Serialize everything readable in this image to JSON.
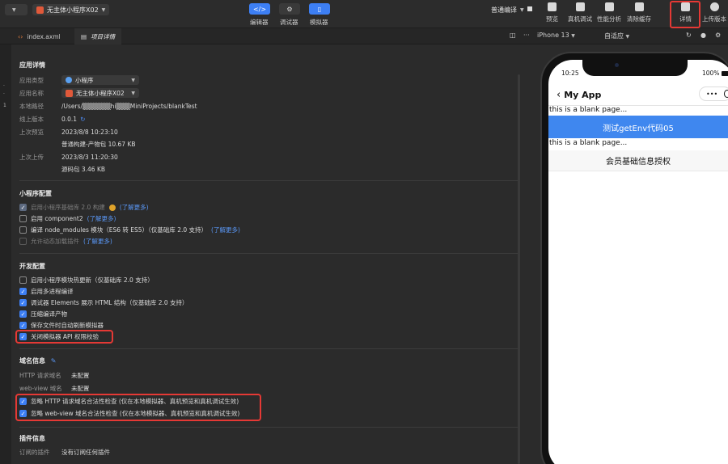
{
  "toolbar": {
    "first_dropdown": "",
    "app_selector": "无主体小程序X02",
    "modes": [
      {
        "label": "编辑器",
        "icon": "code-icon"
      },
      {
        "label": "调试器",
        "icon": "settings-sliders-icon"
      },
      {
        "label": "模拟器",
        "icon": "phone-icon"
      }
    ],
    "compile_mode": "普通编译",
    "tools": [
      "预览",
      "真机调试",
      "性能分析",
      "清除缓存"
    ],
    "detail": "详情",
    "upload": "上传版本"
  },
  "tabs": [
    {
      "label": "index.axml",
      "icon": "file-code-icon"
    },
    {
      "label": "项目详情",
      "icon": "document-icon"
    }
  ],
  "simulator": {
    "device": "iPhone 13",
    "fit": "自适应"
  },
  "app_details": {
    "heading": "应用详情",
    "rows": [
      {
        "label": "应用类型",
        "value": "小程序"
      },
      {
        "label": "应用名称",
        "value": "无主体小程序X02"
      },
      {
        "label": "本地路径",
        "value": "/Users/▒▒▒▒▒▒hi▒▒▒MiniProjects/blankTest"
      },
      {
        "label": "线上版本",
        "value": "0.0.1"
      },
      {
        "label": "上次预览",
        "value": "2023/8/8 10:23:10",
        "extra": "普通构建-产物包 10.67 KB"
      },
      {
        "label": "上次上传",
        "value": "2023/8/3 11:20:30",
        "extra": "源码包 3.46 KB"
      }
    ]
  },
  "mini_config": {
    "heading": "小程序配置",
    "items": [
      {
        "text": "启用小程序基础库 2.0 构建",
        "link": "(了解更多)",
        "checked": true,
        "disabled": true
      },
      {
        "text": "启用 component2",
        "link": "(了解更多)",
        "checked": false,
        "disabled": false
      },
      {
        "text": "编译 node_modules 模块（ES6 转 ES5）（仅基础库 2.0 支持）",
        "link": "(了解更多)",
        "checked": false,
        "disabled": false
      },
      {
        "text": "允许动态加载插件",
        "link": "(了解更多)",
        "checked": false,
        "disabled": true
      }
    ]
  },
  "dev_config": {
    "heading": "开发配置",
    "items": [
      {
        "text": "启用小程序模块热更新（仅基础库 2.0 支持）",
        "checked": false
      },
      {
        "text": "启用多进程编译",
        "checked": true
      },
      {
        "text": "调试器 Elements 展示 HTML 结构（仅基础库 2.0 支持）",
        "checked": true
      },
      {
        "text": "压缩编译产物",
        "checked": true
      },
      {
        "text": "保存文件时自动刷新模拟器",
        "checked": true
      },
      {
        "text": "关闭模拟器 API 权限校验",
        "checked": true
      }
    ]
  },
  "domain": {
    "heading": "域名信息",
    "rows": [
      {
        "label": "HTTP 请求域名",
        "value": "未配置"
      },
      {
        "label": "web-view 域名",
        "value": "未配置"
      }
    ],
    "checks": [
      {
        "text": "忽略 HTTP 请求域名合法性检查 (仅在本地模拟器、真机预览和真机调试生效)",
        "checked": true
      },
      {
        "text": "忽略 web-view 域名合法性检查 (仅在本地模拟器、真机预览和真机调试生效)",
        "checked": true
      }
    ]
  },
  "plugins": {
    "heading": "插件信息",
    "label": "订阅的插件",
    "value": "没有订阅任何插件"
  },
  "phone": {
    "time": "10:25",
    "battery": "100%",
    "nav_title": "My App",
    "capsule_more": "•••",
    "blank_text": "this is a blank page...",
    "button_primary": "测试getEnv代码05",
    "button_secondary": "会员基础信息授权"
  },
  "colors": {
    "accent": "#3d7ff4",
    "highlight_border": "#e53935",
    "phone_button": "#3f87ef"
  }
}
